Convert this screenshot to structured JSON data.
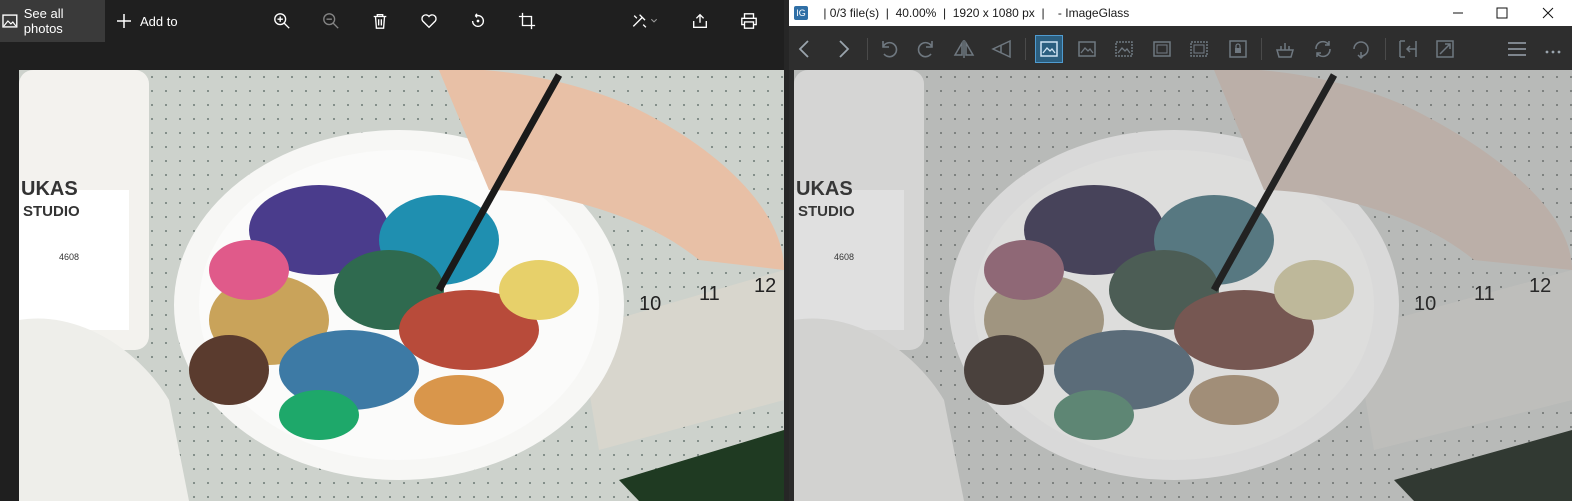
{
  "photos": {
    "toolbar": {
      "see_all_label": "See all photos",
      "add_to_label": "Add to",
      "icons": [
        "zoom-in-icon",
        "zoom-out-icon",
        "delete-icon",
        "favorite-icon",
        "rotate-icon",
        "crop-icon",
        "edit-icon",
        "share-icon",
        "print-icon"
      ]
    },
    "image_text": {
      "brand": "UKAS",
      "brand_sub": "STUDIO",
      "code": "4608",
      "ruler_marks": [
        "10",
        "11",
        "12"
      ]
    }
  },
  "imageglass": {
    "title": " | 0/3 file(s)  |  40.00%  |  1920 x 1080 px  |    - ImageGlass",
    "app_icon_text": "IG",
    "toolbar_icons": [
      "prev-icon",
      "next-icon",
      "rotate-left-icon",
      "rotate-right-icon",
      "flip-horizontal-icon",
      "flip-vertical-icon",
      "zoom-auto-icon",
      "zoom-fit-icon",
      "zoom-width-icon",
      "zoom-height-icon",
      "zoom-fill-icon",
      "zoom-lock-icon",
      "open-with-icon",
      "refresh-icon",
      "reload-icon",
      "fit-window-icon",
      "fullscreen-icon",
      "menu-icon",
      "more-icon"
    ],
    "active_icon": "zoom-auto-icon",
    "image_text": {
      "brand": "UKAS",
      "brand_sub": "STUDIO",
      "code": "4608",
      "ruler_marks": [
        "10",
        "11",
        "12"
      ]
    }
  },
  "colors": {
    "photos_bg": "#1f1f1f",
    "see_all_bg": "#3a3a3a",
    "ig_toolbar": "#2e2e2e",
    "ig_active": "#2c5f80"
  }
}
